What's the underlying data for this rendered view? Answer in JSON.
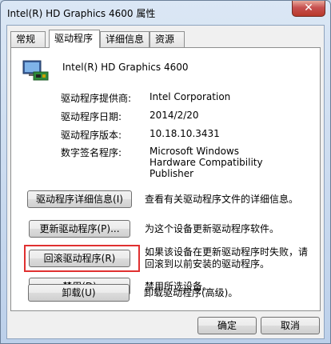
{
  "window": {
    "title": "Intel(R) HD Graphics 4600 属性",
    "close": "✕"
  },
  "tabs": [
    {
      "label": "常规"
    },
    {
      "label": "驱动程序"
    },
    {
      "label": "详细信息"
    },
    {
      "label": "资源"
    }
  ],
  "device": {
    "name": "Intel(R) HD Graphics 4600",
    "icon": "display-adapter-icon"
  },
  "info": [
    {
      "label": "驱动程序提供商:",
      "value": "Intel Corporation"
    },
    {
      "label": "驱动程序日期:",
      "value": "2014/2/20"
    },
    {
      "label": "驱动程序版本:",
      "value": "10.18.10.3431"
    },
    {
      "label": "数字签名程序:",
      "value": "Microsoft Windows Hardware Compatibility Publisher"
    }
  ],
  "actions": [
    {
      "label": "驱动程序详细信息(I)",
      "desc": "查看有关驱动程序文件的详细信息。"
    },
    {
      "label": "更新驱动程序(P)...",
      "desc": "为这个设备更新驱动程序软件。"
    },
    {
      "label": "回滚驱动程序(R)",
      "desc": "如果该设备在更新驱动程序时失败，请回滚到以前安装的驱动程序。"
    },
    {
      "label": "禁用(D)",
      "desc": "禁用所选设备。"
    },
    {
      "label": "卸载(U)",
      "desc": "卸载驱动程序(高级)。"
    }
  ],
  "footer": {
    "ok": "确定",
    "cancel": "取消"
  },
  "colors": {
    "highlight": "#e03030"
  }
}
